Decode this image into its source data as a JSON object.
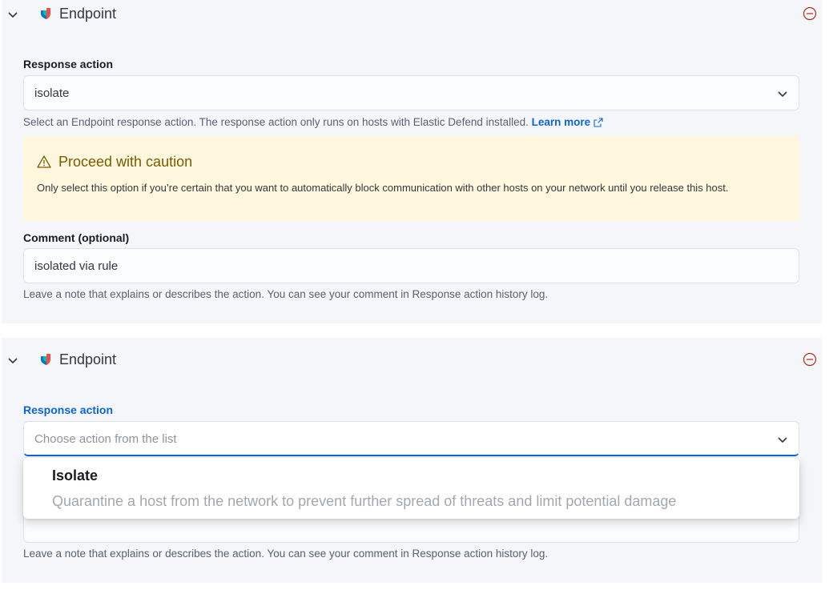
{
  "panel1": {
    "title": "Endpoint",
    "response_action_label": "Response action",
    "response_action_value": "isolate",
    "response_action_help": "Select an Endpoint response action. The response action only runs on hosts with Elastic Defend installed.",
    "learn_more": "Learn more",
    "callout_title": "Proceed with caution",
    "callout_body": "Only select this option if you’re certain that you want to automatically block communication with other hosts on your network until you release this host.",
    "comment_label": "Comment (optional)",
    "comment_value": "isolated via rule",
    "comment_help": "Leave a note that explains or describes the action. You can see your comment in Response action history log."
  },
  "panel2": {
    "title": "Endpoint",
    "response_action_label": "Response action",
    "response_action_placeholder": "Choose action from the list",
    "dropdown": {
      "option_title": "Isolate",
      "option_description": "Quarantine a host from the network to prevent further spread of threats and limit potential damage"
    },
    "comment_help": "Leave a note that explains or describes the action. You can see your comment in Response action history log."
  },
  "colors": {
    "accent": "#0b64dd",
    "danger": "#bd271e",
    "warning_bg": "#fff7dd",
    "warning_text": "#7a5b00"
  }
}
